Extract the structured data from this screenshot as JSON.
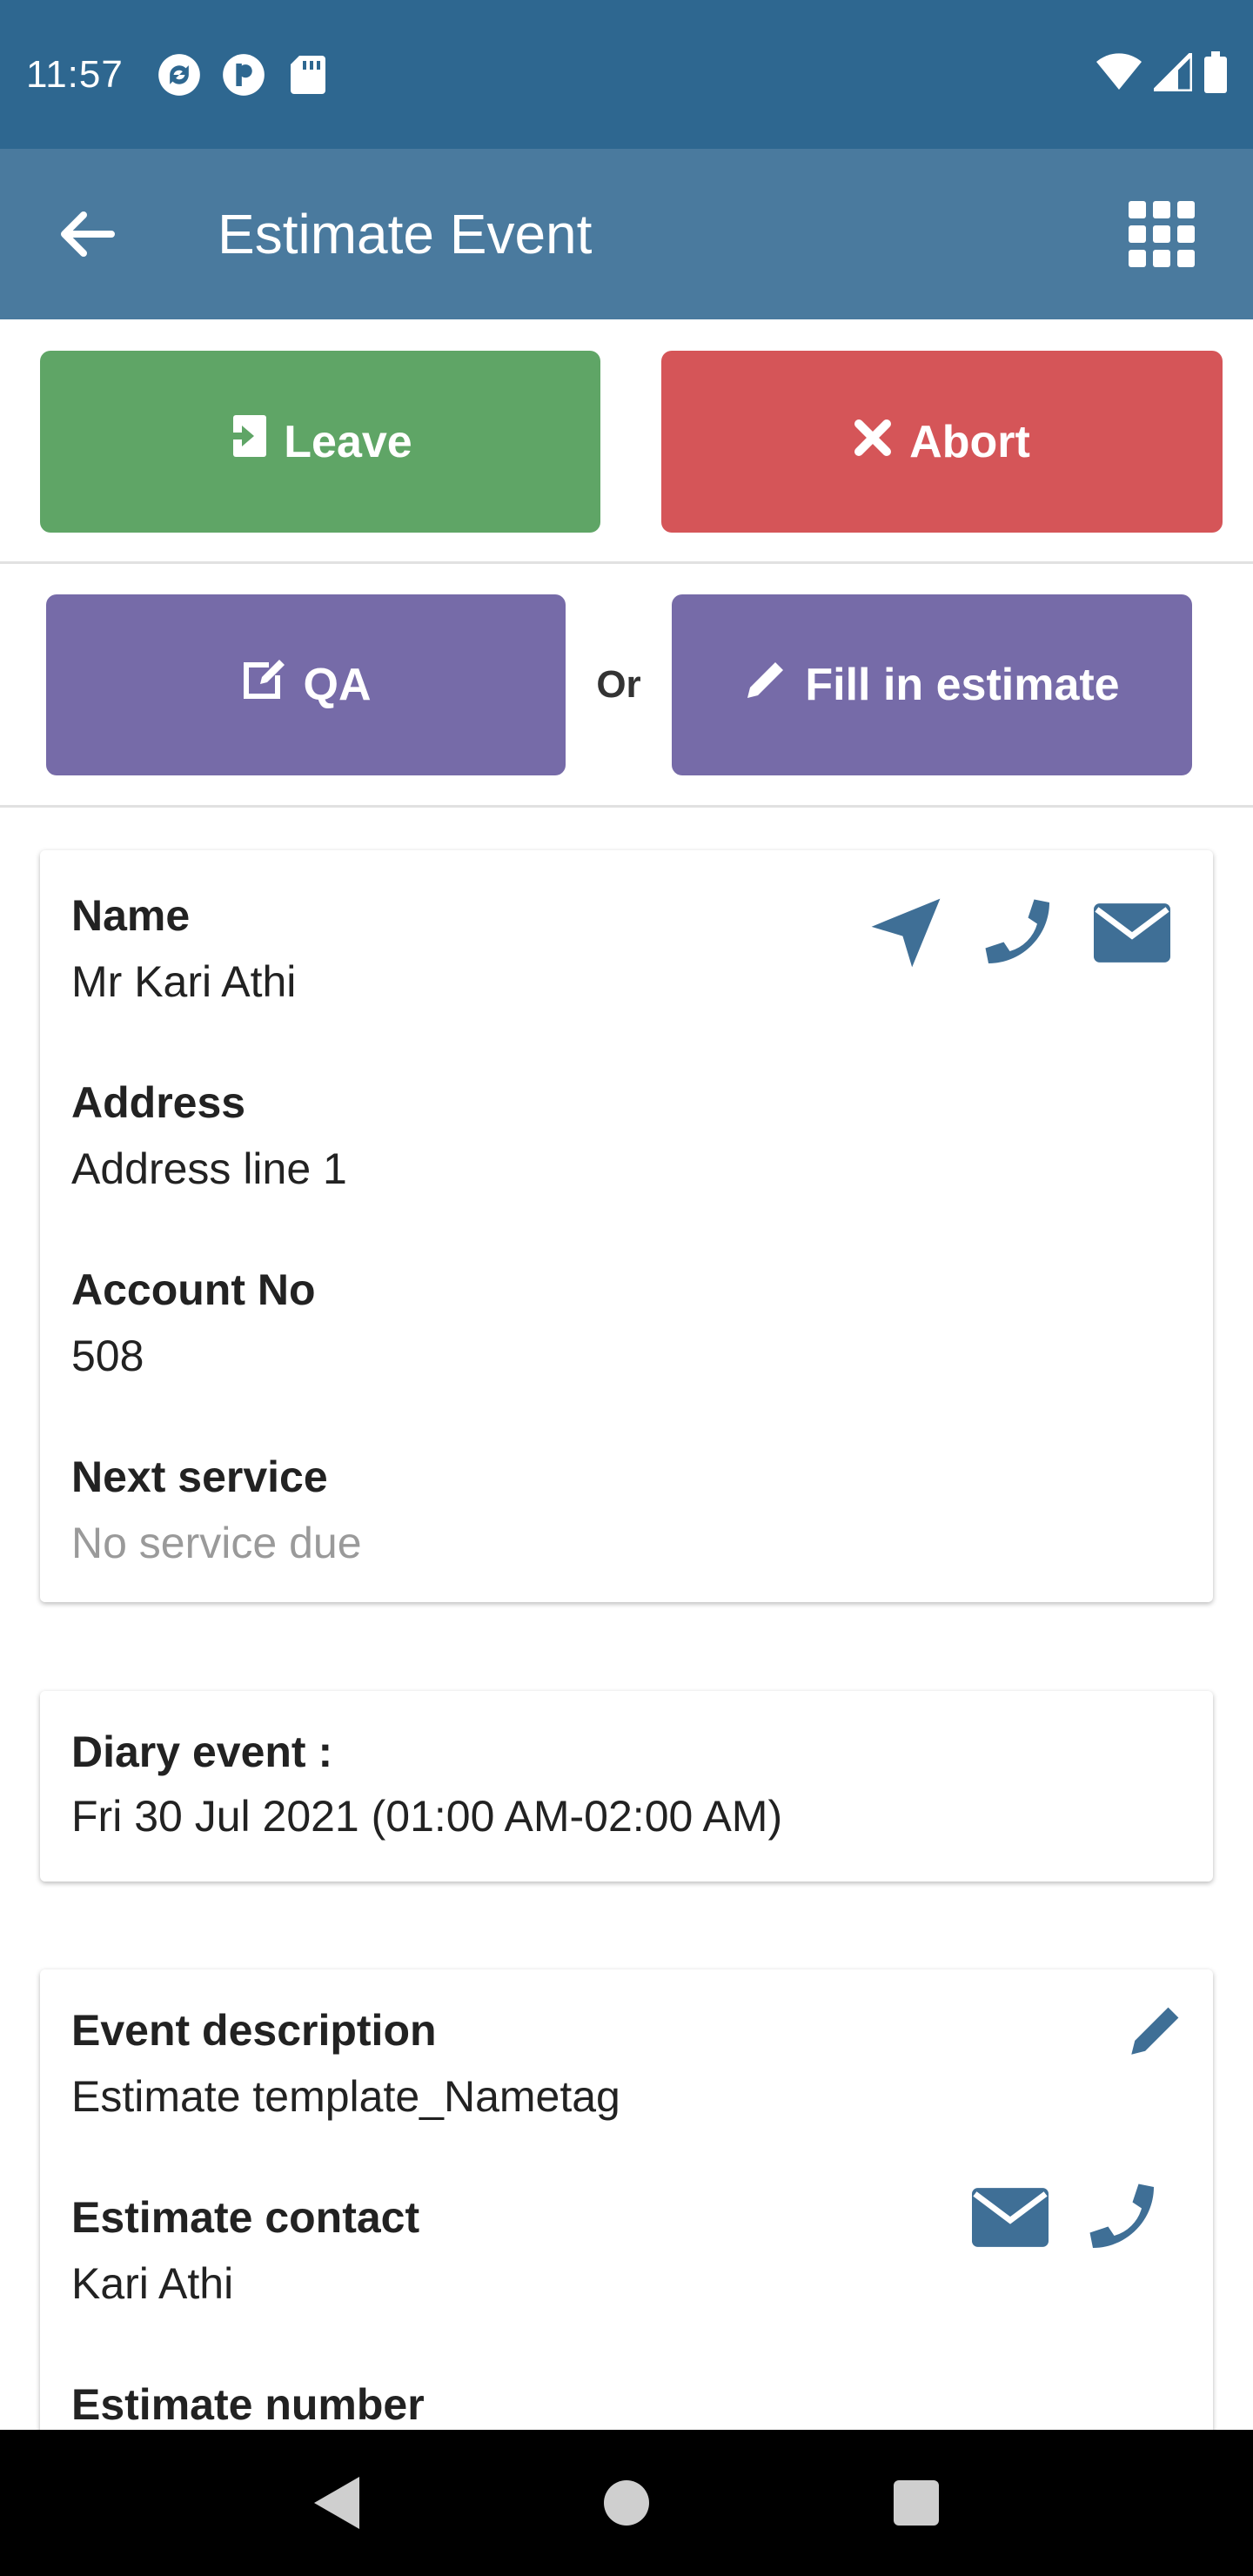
{
  "status_bar": {
    "time": "11:57",
    "icons_left": [
      "sync-icon",
      "app-p-icon",
      "sd-card-icon"
    ],
    "icons_right": [
      "wifi-icon",
      "signal-icon",
      "battery-icon"
    ]
  },
  "app_bar": {
    "title": "Estimate Event",
    "back_icon": "arrow-left-icon",
    "menu_icon": "grid-icon"
  },
  "actions": {
    "leave_label": "Leave",
    "abort_label": "Abort",
    "qa_label": "QA",
    "or_label": "Or",
    "fill_label": "Fill in estimate"
  },
  "customer_card": {
    "name_label": "Name",
    "name_value": "Mr Kari Athi",
    "address_label": "Address",
    "address_value": "Address line 1",
    "account_label": "Account No",
    "account_value": "508",
    "next_service_label": "Next service",
    "next_service_value": "No service due"
  },
  "diary_card": {
    "label": "Diary event :",
    "value": "Fri 30 Jul 2021 (01:00 AM-02:00 AM)"
  },
  "event_card": {
    "description_label": "Event description",
    "description_value": "Estimate template_Nametag",
    "contact_label": "Estimate contact",
    "contact_value": "Kari Athi",
    "number_label": "Estimate number"
  },
  "colors": {
    "status_bar": "#2e6790",
    "app_bar": "#4a7a9e",
    "leave": "#5fa566",
    "abort": "#d55558",
    "purple": "#766ba8",
    "icon_blue": "#3f6f96"
  }
}
